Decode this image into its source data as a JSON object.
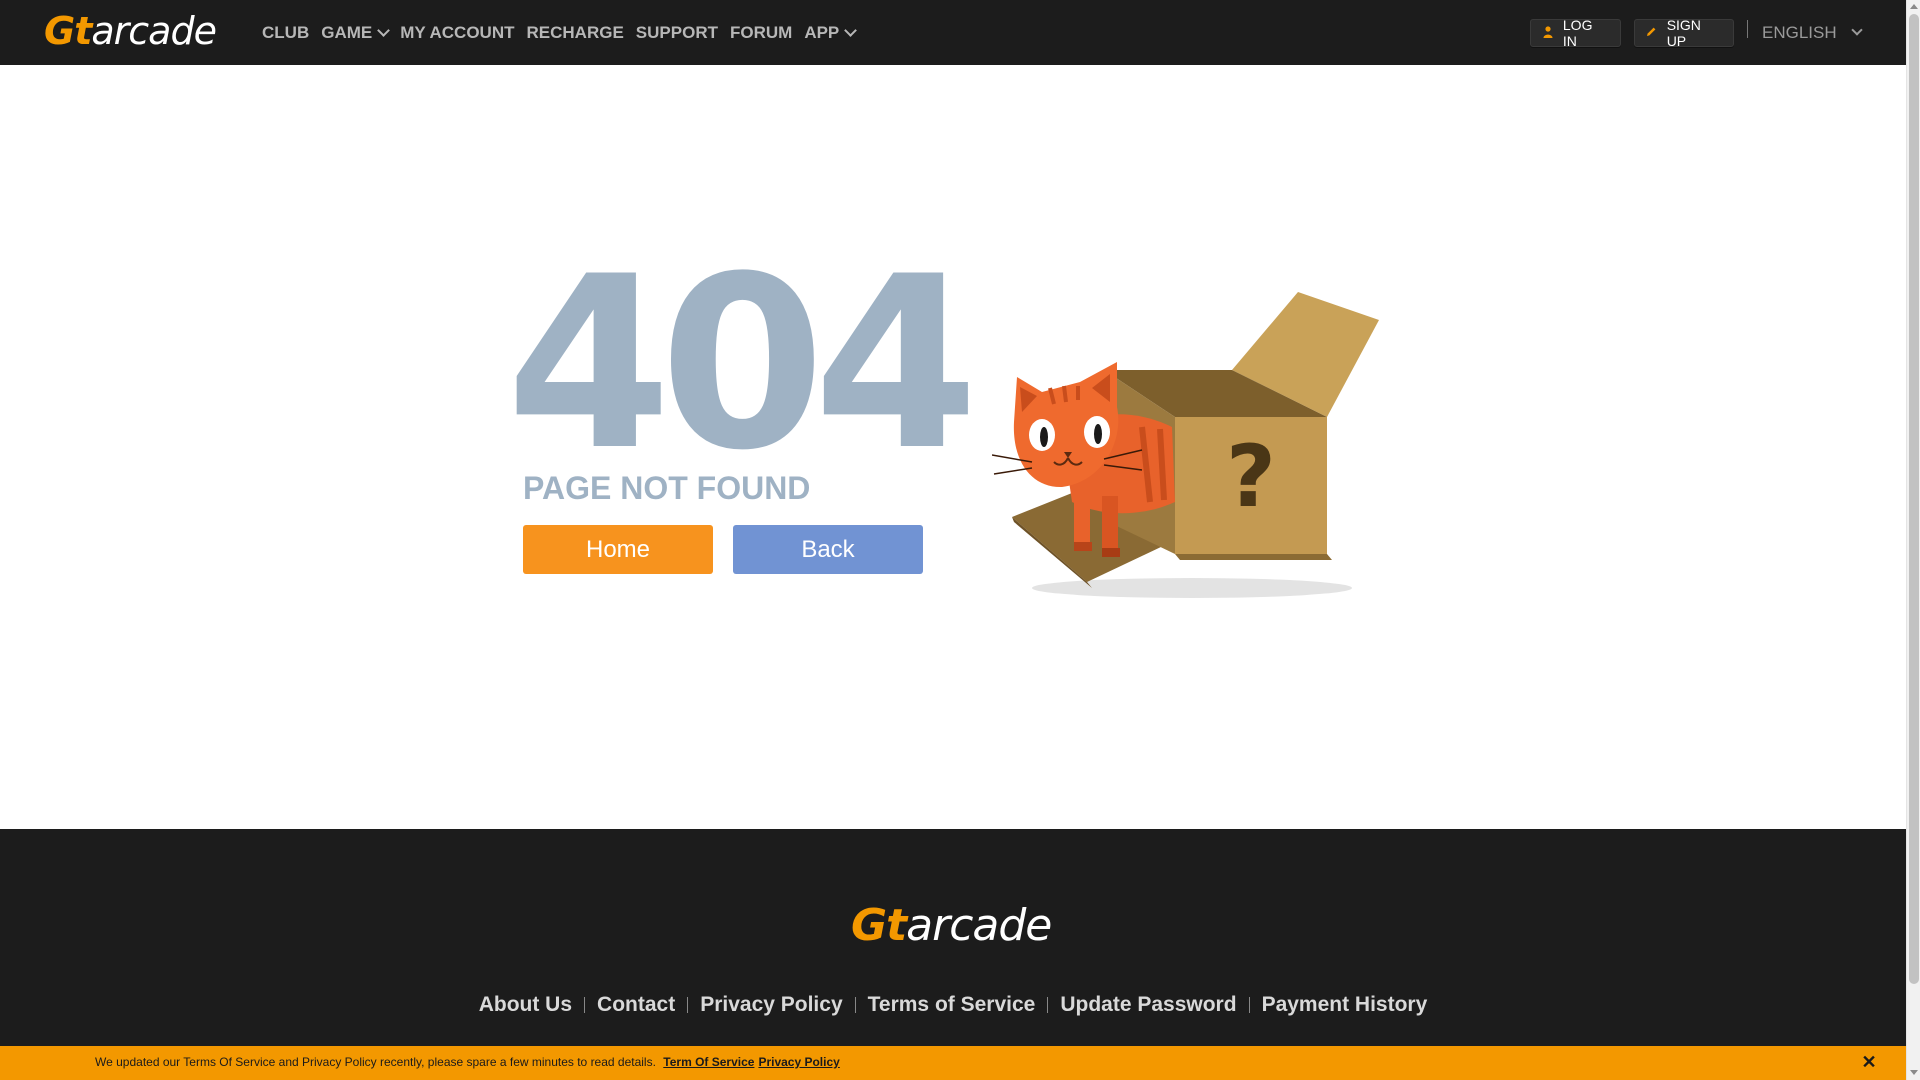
{
  "header": {
    "logo": {
      "g": "Gt",
      "rest": "arcade"
    },
    "nav": [
      {
        "label": "CLUB",
        "has_dropdown": false
      },
      {
        "label": "GAME",
        "has_dropdown": true
      },
      {
        "label": "MY ACCOUNT",
        "has_dropdown": false
      },
      {
        "label": "RECHARGE",
        "has_dropdown": false
      },
      {
        "label": "SUPPORT",
        "has_dropdown": false
      },
      {
        "label": "FORUM",
        "has_dropdown": false
      },
      {
        "label": "APP",
        "has_dropdown": true
      }
    ],
    "login_label": "LOG IN",
    "signup_label": "SIGN UP",
    "language": "ENGLISH"
  },
  "main": {
    "code": "404",
    "message": "PAGE NOT FOUND",
    "home_label": "Home",
    "back_label": "Back",
    "illustration_mark": "?"
  },
  "footer": {
    "logo": {
      "g": "Gt",
      "rest": "arcade"
    },
    "links": [
      "About Us",
      "Contact",
      "Privacy Policy",
      "Terms of Service",
      "Update Password",
      "Payment History"
    ]
  },
  "notice": {
    "text": "We updated our Terms Of Service and Privacy Policy recently, please spare a few minutes to read details.",
    "tos_link": "Term Of Service",
    "privacy_link": "Privacy Policy",
    "close_symbol": "✕"
  },
  "colors": {
    "brand_orange": "#f39800",
    "header_bg": "#1c1c1c",
    "code_color": "#9fb2c4",
    "home_button": "#f7931e",
    "back_button": "#7193d3"
  },
  "icons": {
    "login": "user-icon",
    "signup": "pencil-icon",
    "language": "chevron-down-icon",
    "close": "close-icon"
  }
}
